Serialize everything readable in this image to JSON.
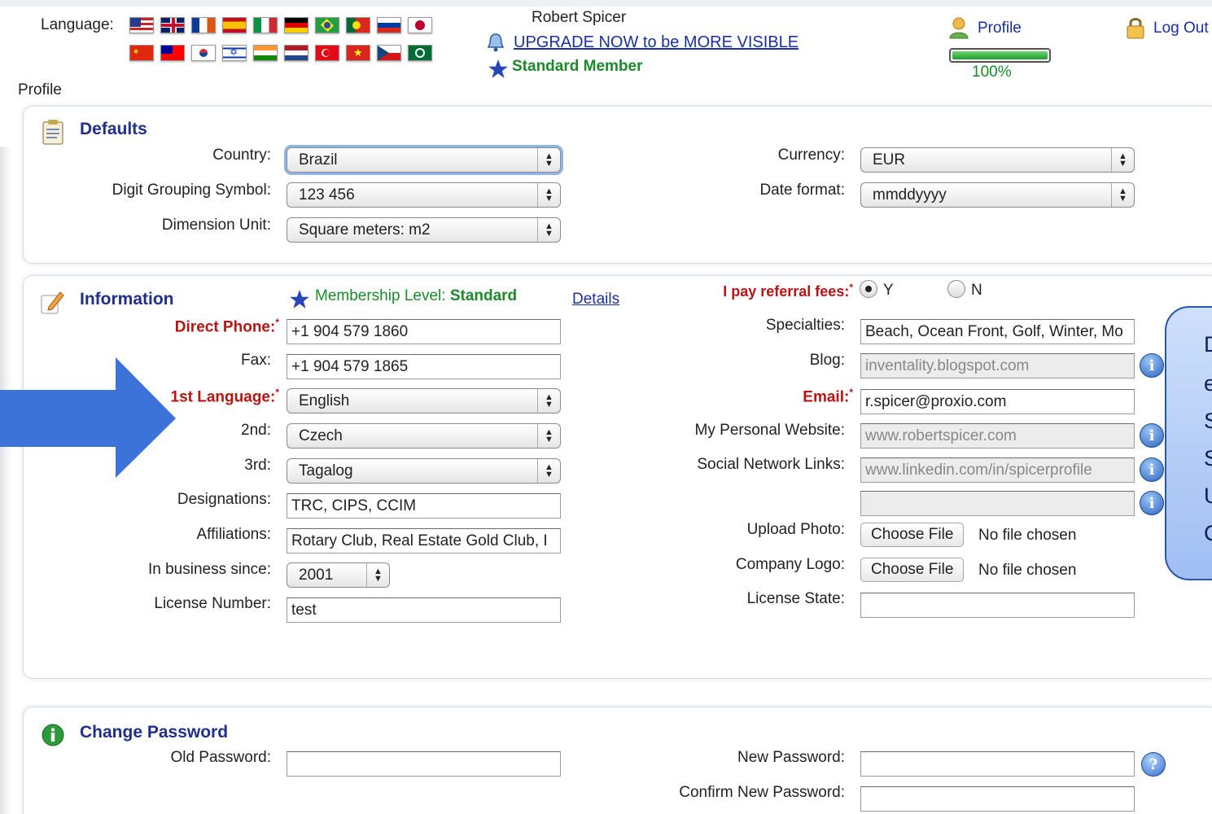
{
  "header": {
    "language_label": "Language:",
    "user_name": "Robert Spicer",
    "upgrade_link": "UPGRADE NOW to be MORE VISIBLE",
    "member_status": "Standard Member",
    "profile_link": "Profile",
    "logout_link": "Log Out",
    "progress_value": 1.0,
    "progress_text": "100%",
    "breadcrumb": "Profile"
  },
  "flags": [
    "us",
    "uk",
    "france",
    "spain",
    "italy",
    "germany",
    "brazil",
    "portugal",
    "russia",
    "japan",
    "china",
    "taiwan",
    "korea",
    "israel",
    "india",
    "netherlands",
    "turkey",
    "vietnam",
    "czech",
    "saudi-arabia"
  ],
  "defaults": {
    "title": "Defaults",
    "country_label": "Country:",
    "country_value": "Brazil",
    "digit_label": "Digit Grouping Symbol:",
    "digit_value": "123 456",
    "dimension_label": "Dimension Unit:",
    "dimension_value": "Square meters: m2",
    "currency_label": "Currency:",
    "currency_value": "EUR",
    "dateformat_label": "Date format:",
    "dateformat_value": "mmddyyyy"
  },
  "information": {
    "title": "Information",
    "membership_label": "Membership Level:",
    "membership_value": "Standard",
    "details_link": "Details",
    "direct_phone_label": "Direct Phone:",
    "direct_phone_value": "+1 904 579 1860",
    "fax_label": "Fax:",
    "fax_value": "+1 904 579 1865",
    "lang1_label": "1st Language:",
    "lang1_value": "English",
    "lang2_label": "2nd:",
    "lang2_value": "Czech",
    "lang3_label": "3rd:",
    "lang3_value": "Tagalog",
    "designations_label": "Designations:",
    "designations_value": "TRC, CIPS, CCIM",
    "affiliations_label": "Affiliations:",
    "affiliations_value": "Rotary Club, Real Estate Gold Club, I",
    "since_label": "In business since:",
    "since_value": "2001",
    "license_label": "License Number:",
    "license_value": "test",
    "referral_label": "I pay referral fees:",
    "referral_yes": "Y",
    "referral_no": "N",
    "specialties_label": "Specialties:",
    "specialties_value": "Beach, Ocean Front, Golf, Winter, Mo",
    "blog_label": "Blog:",
    "blog_placeholder": "inventality.blogspot.com",
    "email_label": "Email:",
    "email_value": "r.spicer@proxio.com",
    "website_label": "My Personal Website:",
    "website_placeholder": "www.robertspicer.com",
    "social_label": "Social Network Links:",
    "social_placeholder": "www.linkedin.com/in/spicerprofile",
    "upload_photo_label": "Upload Photo:",
    "company_logo_label": "Company Logo:",
    "choose_file": "Choose File",
    "no_file": "No file chosen",
    "license_state_label": "License State:",
    "required_mark": "*"
  },
  "password": {
    "title": "Change Password",
    "old_label": "Old Password:",
    "new_label": "New Password:",
    "confirm_label": "Confirm New Password:"
  },
  "callout": {
    "lines": [
      "D",
      "e",
      "S",
      "S",
      "U",
      "C"
    ]
  },
  "colors": {
    "link_blue": "#1a2fa0",
    "required_red": "#b81414",
    "member_green": "#1a8a2a",
    "arrow_blue": "#3b73d8"
  }
}
